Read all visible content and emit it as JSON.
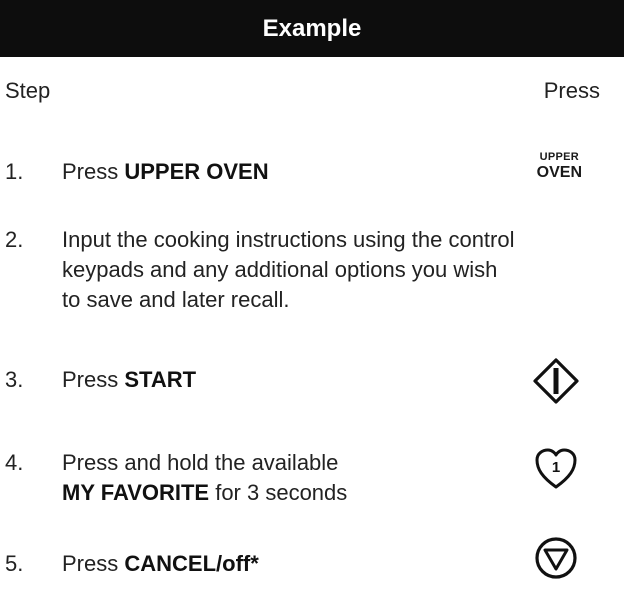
{
  "header": {
    "title": "Example"
  },
  "columns": {
    "step": "Step",
    "press": "Press"
  },
  "steps": [
    {
      "num": "1.",
      "pre": "Press ",
      "bold": "UPPER OVEN",
      "post": ""
    },
    {
      "num": "2.",
      "line1": "Input the cooking instructions using the control",
      "line2": "keypads and any additional options you wish",
      "line3": "to save and later recall."
    },
    {
      "num": "3.",
      "pre": "Press ",
      "bold": "START"
    },
    {
      "num": "4.",
      "line1": "Press and hold the available",
      "bold": "MY FAVORITE",
      "post": " for 3 seconds"
    },
    {
      "num": "5.",
      "pre": "Press ",
      "bold": "CANCEL/off*"
    }
  ],
  "icons": {
    "upper_oven": {
      "line1": "UPPER",
      "line2": "OVEN"
    },
    "favorite_number": "1"
  }
}
